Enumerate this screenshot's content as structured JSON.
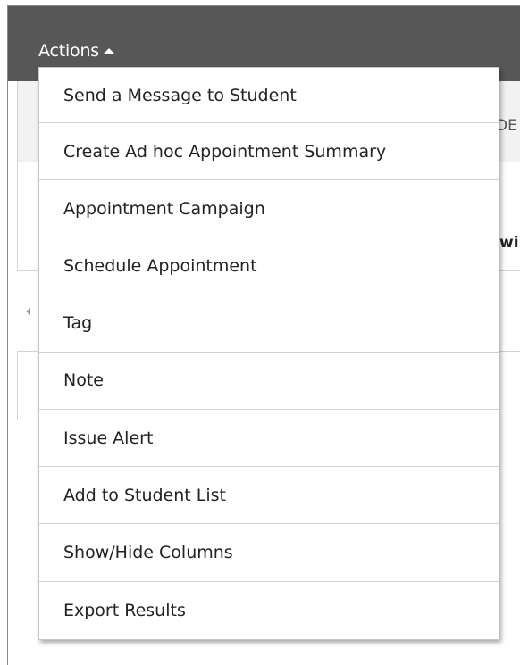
{
  "actions": {
    "label": "Actions",
    "icon": "caret-up-icon"
  },
  "background": {
    "header_partial_text": "DE",
    "row_partial_text": "wi"
  },
  "menu": {
    "items": [
      {
        "label": "Send a Message to Student"
      },
      {
        "label": "Create Ad hoc Appointment Summary"
      },
      {
        "label": "Appointment Campaign"
      },
      {
        "label": "Schedule Appointment"
      },
      {
        "label": "Tag"
      },
      {
        "label": "Note"
      },
      {
        "label": "Issue Alert"
      },
      {
        "label": "Add to Student List"
      },
      {
        "label": "Show/Hide Columns"
      },
      {
        "label": "Export Results"
      }
    ]
  },
  "colors": {
    "header_bg": "#575757",
    "menu_bg": "#ffffff",
    "menu_text": "#222222"
  }
}
